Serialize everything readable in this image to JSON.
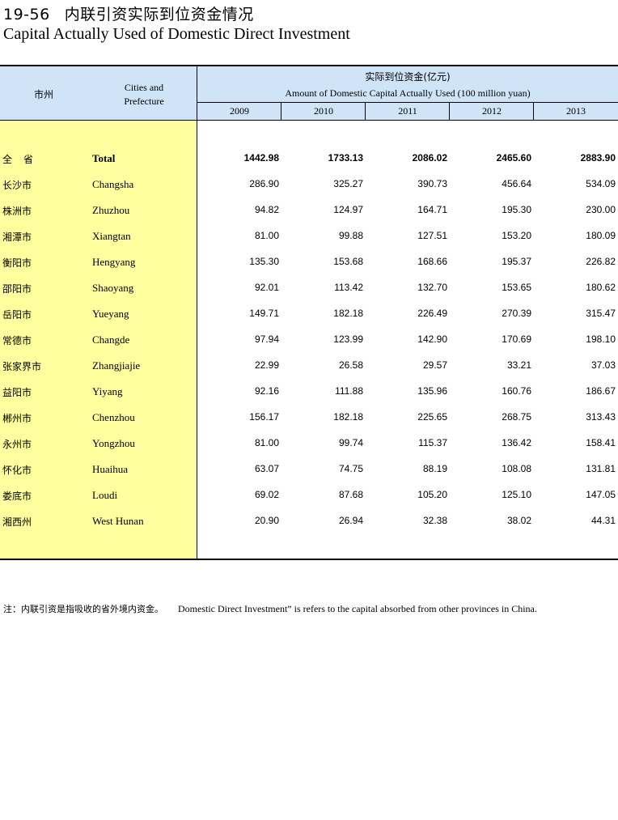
{
  "title": {
    "number": "19-56",
    "cn": "内联引资实际到位资金情况",
    "en": "Capital Actually Used of Domestic Direct Investment"
  },
  "header": {
    "city_cn": "市州",
    "city_en_line1": "Cities and",
    "city_en_line2": "Prefecture",
    "amount_cn": "实际到位资金(亿元)",
    "amount_en": "Amount of Domestic Capital Actually Used  (100 million yuan)",
    "years": [
      "2009",
      "2010",
      "2011",
      "2012",
      "2013"
    ]
  },
  "rows": [
    {
      "cn": "全省",
      "en": "Total",
      "v": [
        "1442.98",
        "1733.13",
        "2086.02",
        "2465.60",
        "2883.90"
      ]
    },
    {
      "cn": "长沙市",
      "en": "Changsha",
      "v": [
        "286.90",
        "325.27",
        "390.73",
        "456.64",
        "534.09"
      ]
    },
    {
      "cn": "株洲市",
      "en": "Zhuzhou",
      "v": [
        "94.82",
        "124.97",
        "164.71",
        "195.30",
        "230.00"
      ]
    },
    {
      "cn": "湘潭市",
      "en": "Xiangtan",
      "v": [
        "81.00",
        "99.88",
        "127.51",
        "153.20",
        "180.09"
      ]
    },
    {
      "cn": "衡阳市",
      "en": "Hengyang",
      "v": [
        "135.30",
        "153.68",
        "168.66",
        "195.37",
        "226.82"
      ]
    },
    {
      "cn": "邵阳市",
      "en": "Shaoyang",
      "v": [
        "92.01",
        "113.42",
        "132.70",
        "153.65",
        "180.62"
      ]
    },
    {
      "cn": "岳阳市",
      "en": "Yueyang",
      "v": [
        "149.71",
        "182.18",
        "226.49",
        "270.39",
        "315.47"
      ]
    },
    {
      "cn": "常德市",
      "en": "Changde",
      "v": [
        "97.94",
        "123.99",
        "142.90",
        "170.69",
        "198.10"
      ]
    },
    {
      "cn": "张家界市",
      "en": "Zhangjiajie",
      "v": [
        "22.99",
        "26.58",
        "29.57",
        "33.21",
        "37.03"
      ]
    },
    {
      "cn": "益阳市",
      "en": "Yiyang",
      "v": [
        "92.16",
        "111.88",
        "135.96",
        "160.76",
        "186.67"
      ]
    },
    {
      "cn": "郴州市",
      "en": "Chenzhou",
      "v": [
        "156.17",
        "182.18",
        "225.65",
        "268.75",
        "313.43"
      ]
    },
    {
      "cn": "永州市",
      "en": "Yongzhou",
      "v": [
        "81.00",
        "99.74",
        "115.37",
        "136.42",
        "158.41"
      ]
    },
    {
      "cn": "怀化市",
      "en": "Huaihua",
      "v": [
        "63.07",
        "74.75",
        "88.19",
        "108.08",
        "131.81"
      ]
    },
    {
      "cn": "娄底市",
      "en": "Loudi",
      "v": [
        "69.02",
        "87.68",
        "105.20",
        "125.10",
        "147.05"
      ]
    },
    {
      "cn": "湘西州",
      "en": "West Hunan",
      "v": [
        "20.90",
        "26.94",
        "32.38",
        "38.02",
        "44.31"
      ]
    }
  ],
  "note": {
    "cn": "注：内联引资是指吸收的省外境内资金。",
    "en": "Domestic Direct Investment” is refers to the capital absorbed from other provinces in China."
  },
  "colors": {
    "header_bg": "#cfe4f7",
    "left_col_bg": "#ffff9f"
  }
}
